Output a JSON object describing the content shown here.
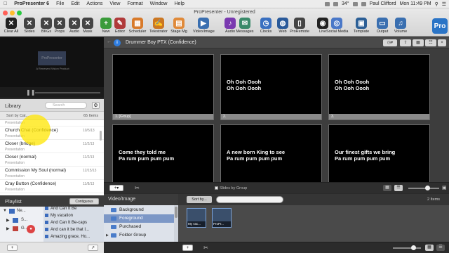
{
  "menubar": {
    "app_name": "ProPresenter 6",
    "items": [
      "File",
      "Edit",
      "Actions",
      "View",
      "Format",
      "Window",
      "Help"
    ],
    "status_text": "34°",
    "user": "Paul Clifford",
    "clock": "Mon 11:49 PM"
  },
  "window_title": "ProPresenter - Unregistered",
  "toolbar": {
    "items": [
      {
        "label": "Clear All",
        "icon": "x-icon",
        "color": "#222222"
      },
      {
        "label": "Slides",
        "icon": "x-icon",
        "color": "#444444"
      },
      {
        "label": "BKGs",
        "icon": "x-icon",
        "color": "#444444"
      },
      {
        "label": "Props",
        "icon": "x-icon",
        "color": "#444444"
      },
      {
        "label": "Audio",
        "icon": "x-icon",
        "color": "#444444"
      },
      {
        "label": "Mask",
        "icon": "x-icon",
        "color": "#444444"
      },
      {
        "label": "New",
        "icon": "plus-icon",
        "color": "#3a9b3a"
      },
      {
        "label": "Editor",
        "icon": "pencil-icon",
        "color": "#b03a3a"
      },
      {
        "label": "Scheduler",
        "icon": "calendar-icon",
        "color": "#d87a2a"
      },
      {
        "label": "Telestrator",
        "icon": "pen-icon",
        "color": "#cc7722"
      },
      {
        "label": "Stage Mg",
        "icon": "stage-icon",
        "color": "#e08a3a"
      },
      {
        "label": "Video/Image",
        "icon": "video-icon",
        "color": "#3a6fb0"
      },
      {
        "label": "Audio",
        "icon": "note-icon",
        "color": "#7a3ab0"
      },
      {
        "label": "Messages",
        "icon": "message-icon",
        "color": "#3a8a6a"
      },
      {
        "label": "Clocks",
        "icon": "clock-icon",
        "color": "#3a70c0"
      },
      {
        "label": "Web",
        "icon": "globe-icon",
        "color": "#2a5a9a"
      },
      {
        "label": "ProRemote",
        "icon": "phone-icon",
        "color": "#444444"
      },
      {
        "label": "Live",
        "icon": "live-icon",
        "color": "#222222"
      },
      {
        "label": "Social Media",
        "icon": "social-icon",
        "color": "#4a78c8"
      },
      {
        "label": "Template",
        "icon": "template-icon",
        "color": "#2c5f96"
      },
      {
        "label": "Output",
        "icon": "output-icon",
        "color": "#3a6fb0"
      },
      {
        "label": "Volume",
        "icon": "volume-icon",
        "color": "#3a6fb0"
      }
    ],
    "logo_text": "Pro"
  },
  "preview": {
    "logo_text": "ProPresenter",
    "caption": "A Renewed Vision Product"
  },
  "library": {
    "title": "Library",
    "search_placeholder": "Search",
    "sort_label": "Sort by Cat...",
    "count": "65 Items",
    "items": [
      {
        "name": "",
        "date": "",
        "category": "Presentation"
      },
      {
        "name": "Church Chat (Confidence)",
        "date": "10/5/13",
        "category": "Presentation"
      },
      {
        "name": "Closer (bridge)",
        "date": "11/2/13",
        "category": "Presentation"
      },
      {
        "name": "Closer (normal)",
        "date": "11/2/13",
        "category": "Presentation"
      },
      {
        "name": "Commission My Soul (normal)",
        "date": "12/15/13",
        "category": "Presentation"
      },
      {
        "name": "Cray Button (Confidence)",
        "date": "11/8/13",
        "category": "Presentation"
      }
    ]
  },
  "playlist": {
    "title": "Playlist",
    "button": "Contiguous",
    "groups": [
      "Ne...",
      "S...",
      "G..."
    ],
    "songs": [
      "And Can It Be",
      "My vacation",
      "And Can It Be-caps",
      "And can it be that I...",
      "Amazing grace, Ho..."
    ]
  },
  "document": {
    "title": "Drummer Boy PTX (Confidence)",
    "slides": [
      {
        "text": [
          "",
          ""
        ],
        "label": "1. [Group]"
      },
      {
        "text": [
          "Oh Ooh Oooh",
          "Oh Ooh Oooh"
        ],
        "label": "2."
      },
      {
        "text": [
          "Oh Ooh Oooh",
          "Oh Ooh Oooh"
        ],
        "label": "3."
      },
      {
        "text": [
          "Come they told me",
          "Pa rum pum pum pum"
        ],
        "label": ""
      },
      {
        "text": [
          "A new born King to see",
          "Pa rum pum pum pum"
        ],
        "label": ""
      },
      {
        "text": [
          "Our finest gifts we bring",
          "Pa rum pum pum pum"
        ],
        "label": ""
      }
    ],
    "slides_by_group": "Slides by Group",
    "add_button": "+",
    "scissors": "✂"
  },
  "media": {
    "title": "Video/Image",
    "items": [
      "Background",
      "Foreground",
      "Purchased",
      "Folder Group"
    ],
    "selected": "Foreground",
    "sort_label": "Sort by...",
    "count": "2 Items",
    "thumbs": [
      "My vac...",
      "ProPr..."
    ]
  },
  "footer": {
    "plus": "+",
    "minus": "−",
    "scissors": "✂"
  }
}
